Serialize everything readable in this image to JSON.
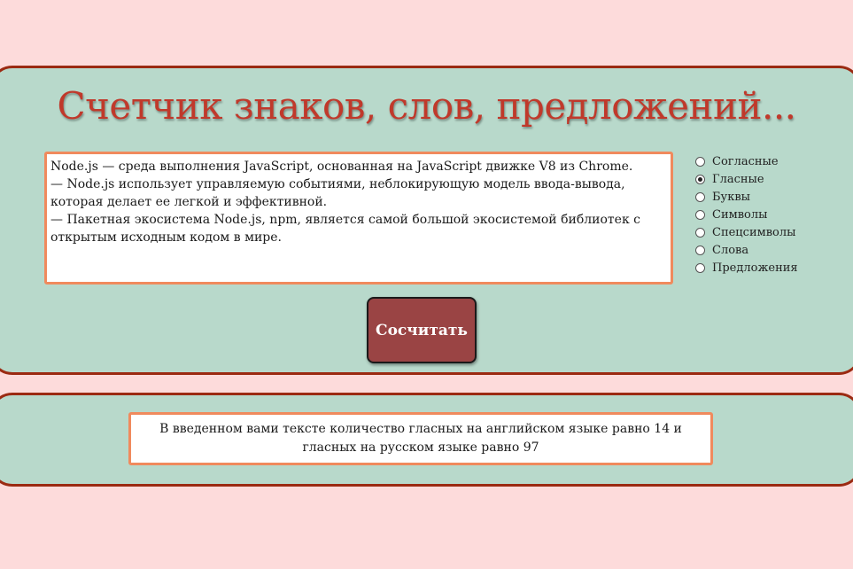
{
  "title": "Счетчик знаков, слов, предложений...",
  "input": {
    "value": "Node.js — среда выполнения JavaScript, основанная на JavaScript движке V8 из Chrome.\n— Node.js использует управляемую событиями, неблокирующую модель ввода-вывода, которая делает ее легкой и эффективной.\n— Пакетная экосистема Node.js, npm, является самой большой экосистемой библиотек с открытым исходным кодом в мире."
  },
  "options": [
    {
      "label": "Согласные",
      "checked": false
    },
    {
      "label": "Гласные",
      "checked": true
    },
    {
      "label": "Буквы",
      "checked": false
    },
    {
      "label": "Символы",
      "checked": false
    },
    {
      "label": "Спецсимволы",
      "checked": false
    },
    {
      "label": "Слова",
      "checked": false
    },
    {
      "label": "Предложения",
      "checked": false
    }
  ],
  "button": {
    "label": "Сосчитать"
  },
  "result": {
    "text": "В введенном вами тексте количество гласных на английском языке равно 14 и гласных на русском языке равно 97"
  },
  "colors": {
    "background": "#fddbdb",
    "panel": "#b8d9cb",
    "panel_border": "#9b2a12",
    "title": "#c0392b",
    "button": "#9a4444",
    "field_border": "#f08a5d"
  }
}
